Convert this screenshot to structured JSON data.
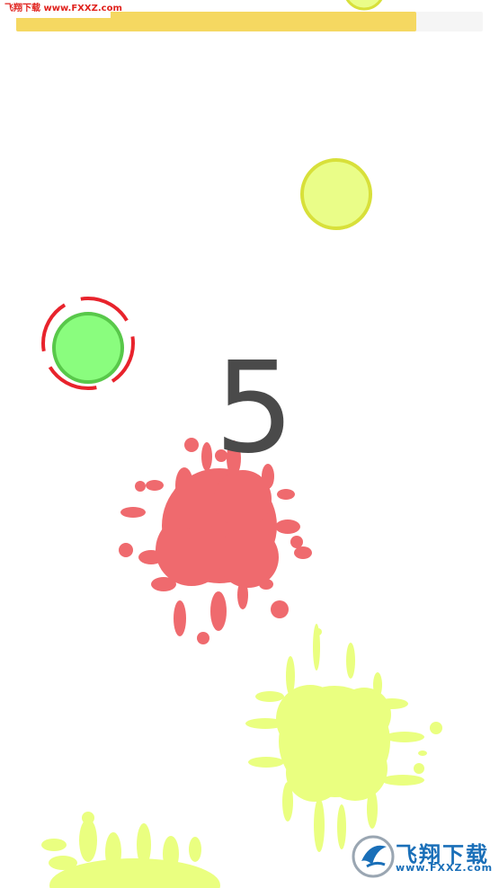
{
  "watermark": {
    "text": "飞翔下载 www.FXXZ.com"
  },
  "level_progress": {
    "fraction": 0.857
  },
  "countdown": {
    "value": "5"
  },
  "colors": {
    "progress_fill": "#f5d861",
    "progress_track": "#f5f5f5",
    "yellow_circle_fill": "#eafd88",
    "yellow_circle_stroke": "#d8e03a",
    "green_circle_fill": "#8afd7e",
    "green_circle_stroke": "#58c84a",
    "target_ring": "#e8232c",
    "red_splat": "#ef6a6e",
    "yellow_splat": "#eaff80",
    "countdown_text": "#4a4a4a"
  },
  "logo": {
    "brand": "飞翔下载",
    "url": "www.FXXZ.com",
    "icon": "fxxz-logo-icon"
  }
}
